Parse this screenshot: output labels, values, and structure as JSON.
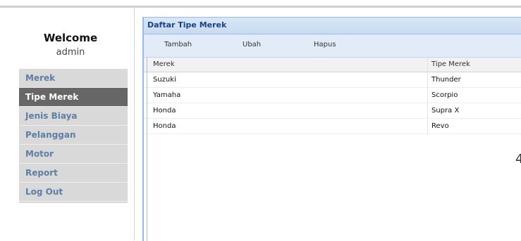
{
  "user": {
    "welcome": "Welcome",
    "name": "admin"
  },
  "sidebar": {
    "items": [
      {
        "label": "Merek",
        "active": false
      },
      {
        "label": "Tipe Merek",
        "active": true
      },
      {
        "label": "Jenis Biaya",
        "active": false
      },
      {
        "label": "Pelanggan",
        "active": false
      },
      {
        "label": "Motor",
        "active": false
      },
      {
        "label": "Report",
        "active": false
      },
      {
        "label": "Log Out",
        "active": false
      }
    ]
  },
  "panel": {
    "title": "Daftar Tipe Merek",
    "toolbar": {
      "add": "Tambah",
      "edit": "Ubah",
      "delete": "Hapus"
    },
    "grid": {
      "headers": {
        "merek": "Merek",
        "tipe": "Tipe Merek"
      },
      "rows": [
        {
          "merek": "Suzuki",
          "tipe": "Thunder"
        },
        {
          "merek": "Yamaha",
          "tipe": "Scorpio"
        },
        {
          "merek": "Honda",
          "tipe": "Supra X"
        },
        {
          "merek": "Honda",
          "tipe": "Revo"
        }
      ]
    }
  },
  "stray_glyph": "4",
  "colors": {
    "active_menu": "#666666",
    "menu_text": "#5d7fa6",
    "panel_border": "#99bbe8",
    "panel_title": "#15428b"
  }
}
